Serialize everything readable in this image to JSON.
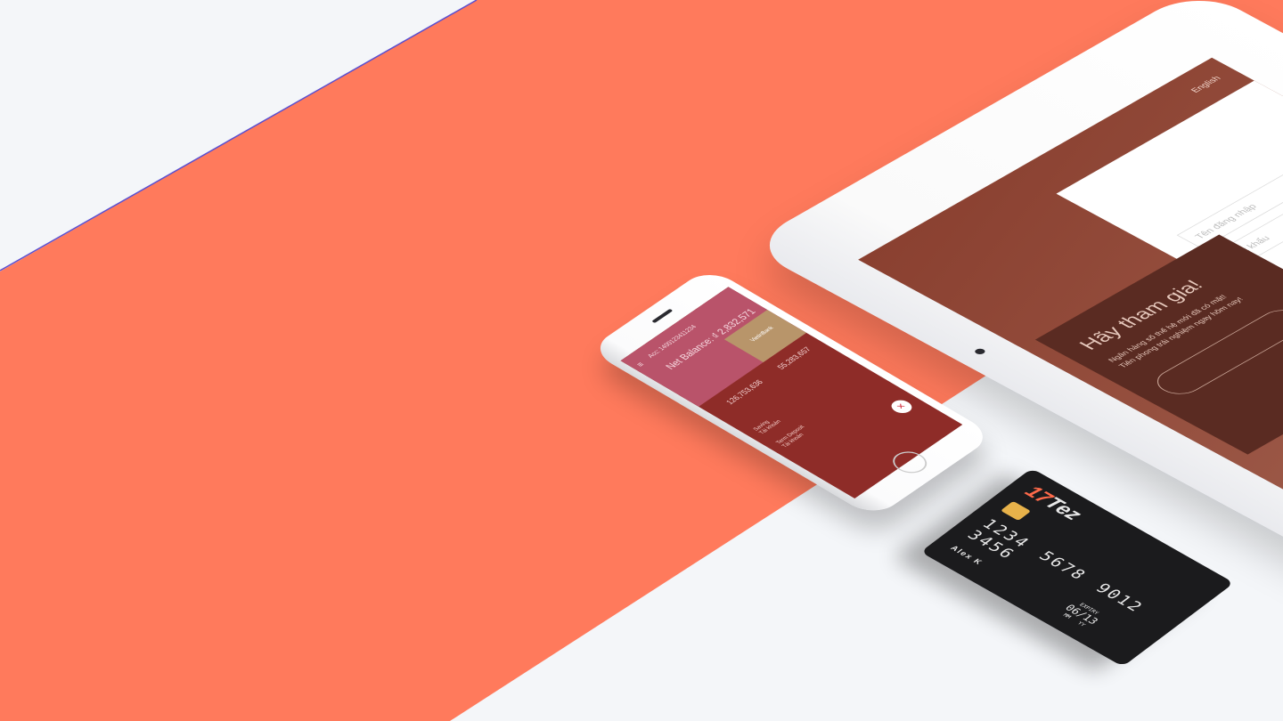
{
  "colors": {
    "background": "#f4f6f9",
    "accent": "#ff7a5c",
    "card": "#1b1b1d"
  },
  "tablet": {
    "language": "English",
    "username_placeholder": "Tên đăng nhập",
    "password_placeholder": "Mật khẩu",
    "join_title": "Hãy tham gia!",
    "join_line1": "Ngân hàng số thế hệ mới đã có mặt!",
    "join_line2": "Tiên phong trải nghiệm ngay hôm nay!"
  },
  "phone": {
    "menu_icon": "hamburger-icon",
    "account": "Acc: 1400123411234",
    "net_balance": "Net Balance: ₫ 2,832,571",
    "brand": "VietinBank",
    "amount_left": "126,753,636",
    "amount_right": "55,283,657",
    "row1_title": "Saving",
    "row1_sub": "Tài khoản",
    "row2_title": "Term Deposit",
    "row2_sub": "Tài khoản",
    "fab": "×"
  },
  "card": {
    "brand_number": "17",
    "brand_name": "Tez",
    "number": "1234 5678 9012 3456",
    "holder": "Alex K",
    "expiry_label": "EXPIRY",
    "expiry": "06/13",
    "month_label": "MM",
    "year_label": "YY"
  }
}
